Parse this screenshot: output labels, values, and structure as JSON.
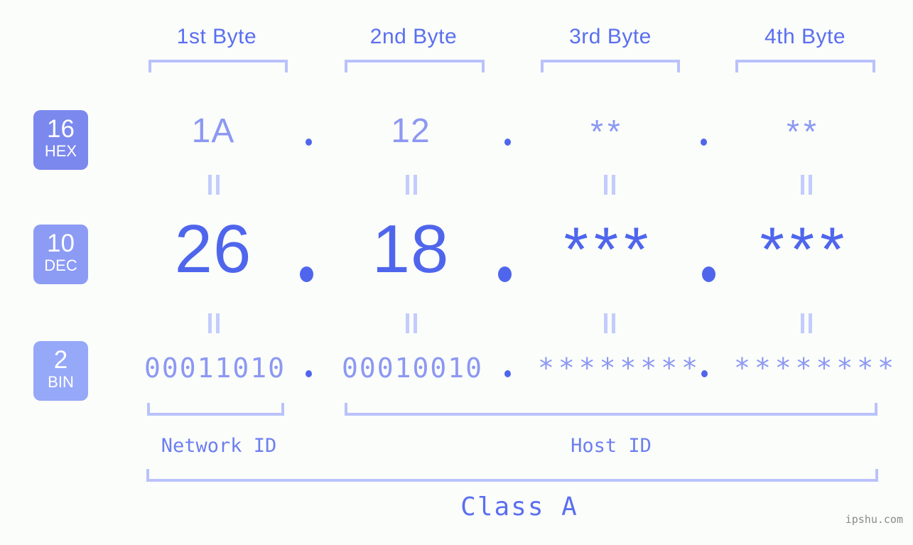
{
  "meta": {
    "watermark": "ipshu.com",
    "accent_strong": "#4f66ec",
    "accent_mid": "#8c98f2",
    "accent_light": "#b9c2fb",
    "background": "#fbfdfa"
  },
  "byte_headers": [
    {
      "label": "1st Byte"
    },
    {
      "label": "2nd Byte"
    },
    {
      "label": "3rd Byte"
    },
    {
      "label": "4th Byte"
    }
  ],
  "rows": [
    {
      "key": "hex",
      "badge_number": "16",
      "badge_abbr": "HEX",
      "badge_color": "#7b88ee",
      "values": [
        "1A",
        "12",
        "**",
        "**"
      ],
      "separators": [
        ".",
        ".",
        "."
      ]
    },
    {
      "key": "dec",
      "badge_number": "10",
      "badge_abbr": "DEC",
      "badge_color": "#8c9bf4",
      "values": [
        "26",
        "18",
        "***",
        "***"
      ],
      "separators": [
        ".",
        ".",
        "."
      ]
    },
    {
      "key": "bin",
      "badge_number": "2",
      "badge_abbr": "BIN",
      "badge_color": "#96a8f8",
      "values": [
        "00011010",
        "00010010",
        "********",
        "********"
      ],
      "separators": [
        ".",
        ".",
        "."
      ]
    }
  ],
  "equals_marks": {
    "symbol": "||"
  },
  "id_labels": [
    {
      "label": "Network ID"
    },
    {
      "label": "Host ID"
    }
  ],
  "class_label": "Class A"
}
